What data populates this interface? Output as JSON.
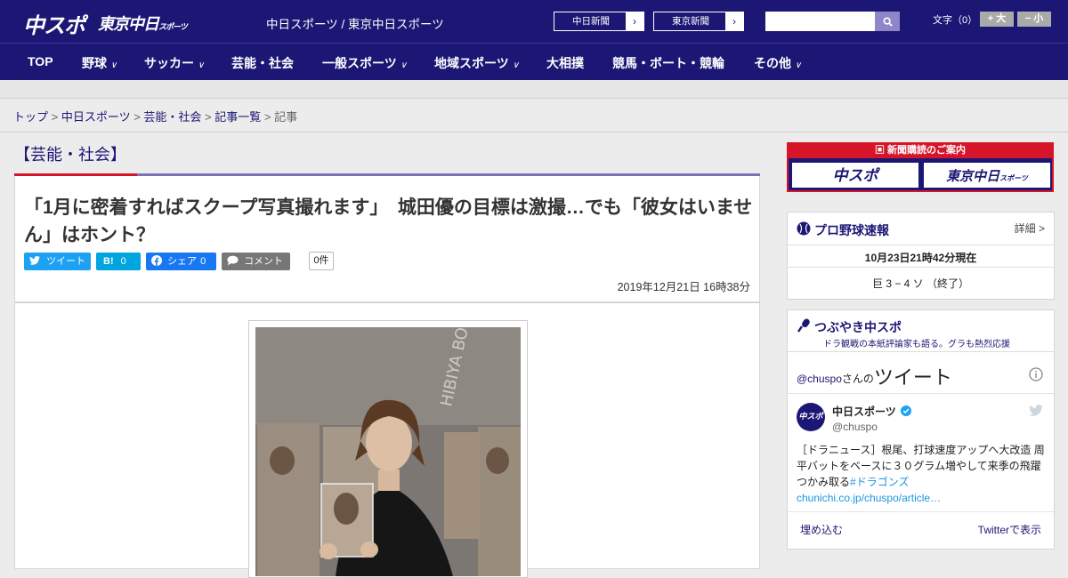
{
  "header": {
    "logo_main": "中スポ",
    "logo_tokyo": "東京中日",
    "logo_tokyo_small": "スポーツ",
    "site_title": "中日スポーツ / 東京中日スポーツ",
    "paper_links": [
      {
        "label": "中日新聞"
      },
      {
        "label": "東京新聞"
      }
    ],
    "search_placeholder": "",
    "font_size_label": "文字（0）",
    "font_bigger": "+ 大",
    "font_smaller": "− 小"
  },
  "nav": {
    "items": [
      {
        "label": "TOP",
        "chevron": false
      },
      {
        "label": "野球",
        "chevron": true
      },
      {
        "label": "サッカー",
        "chevron": true
      },
      {
        "label": "芸能・社会",
        "chevron": false
      },
      {
        "label": "一般スポーツ",
        "chevron": true
      },
      {
        "label": "地域スポーツ",
        "chevron": true
      },
      {
        "label": "大相撲",
        "chevron": false
      },
      {
        "label": "競馬・ボート・競輪",
        "chevron": false
      },
      {
        "label": "その他",
        "chevron": true
      }
    ],
    "chevron": "∨"
  },
  "breadcrumb": {
    "items": [
      "トップ",
      "中日スポーツ",
      "芸能・社会",
      "記事一覧"
    ],
    "current": "記事",
    "separator": " > "
  },
  "article": {
    "category": "【芸能・社会】",
    "headline": "「1月に密着すればスクープ写真撮れます」　城田優の目標は激撮…でも「彼女はいません」はホント？",
    "share": {
      "tweet": "ツイート",
      "hatena": "B!",
      "hatena_count": "0",
      "facebook": "シェア",
      "facebook_count": "0",
      "comment": "コメント",
      "comment_count": "0件"
    },
    "date": "2019年12月21日 16時38分",
    "photo_backdrop_text": "HIBIYA BOOKS"
  },
  "sidebar": {
    "ad_title": "新聞購読のご案内",
    "ad_logo1": "中スポ",
    "ad_logo2": "東京中日",
    "ad_logo2_small": "スポーツ",
    "baseball": {
      "title": "プロ野球速報",
      "detail": "詳細 >",
      "time": "10月23日21時42分現在",
      "score": "巨  3 − 4  ソ  （終了）"
    },
    "twitter": {
      "title": "つぶやき中スポ",
      "subtitle": "ドラ観戦の本紙評論家も語る。グラも熱烈応援",
      "handle_prefix": "@chuspo",
      "handle_suffix": "さんの",
      "tweets_label": "ツイート",
      "account_name": "中日スポーツ",
      "account_handle": "@chuspo",
      "avatar_text": "中スポ",
      "tweet_text": "［ドラニュース］根尾、打球速度アップへ大改造 周平バットをベースに３０グラム増やして来季の飛躍つかみ取る",
      "tweet_hashtag": "#ドラゴンズ",
      "tweet_link": "chunichi.co.jp/chuspo/article…",
      "embed": "埋め込む",
      "view_on_twitter": "Twitterで表示"
    }
  },
  "colors": {
    "brand": "#1c1774",
    "accent_red": "#d7152a",
    "twitter": "#1da1f2",
    "hatena": "#00a4de",
    "facebook": "#1877f2",
    "comment": "#777777"
  }
}
